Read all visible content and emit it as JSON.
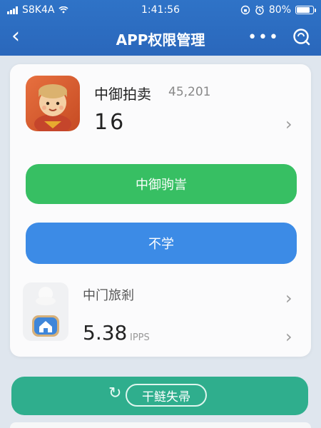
{
  "status_bar": {
    "carrier": "S8K4A",
    "time": "1:41:56",
    "battery": "80%"
  },
  "nav": {
    "title": "APP权限管理",
    "more_label": "•••"
  },
  "card": {
    "app_name": "中御拍卖",
    "app_count": "45,201",
    "big_number": "16",
    "green_button": "中御驹訔",
    "blue_button": "不学",
    "sub_name": "中门旅剎",
    "sub_number": "5.38",
    "sub_unit": "IPPS"
  },
  "bottom_button": {
    "label": "干鲢失帚"
  },
  "colors": {
    "header": "#2f73c7",
    "green": "#37bf63",
    "blue": "#3c8be6",
    "teal": "#2fae8d"
  }
}
